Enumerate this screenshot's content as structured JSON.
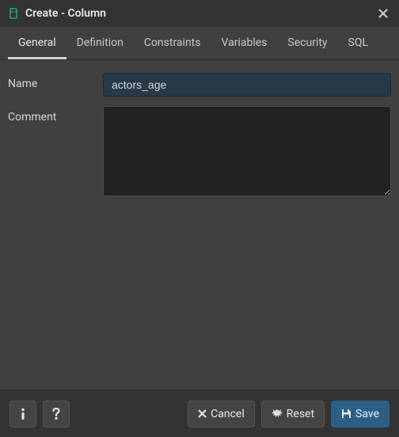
{
  "titlebar": {
    "title": "Create - Column"
  },
  "tabs": [
    {
      "label": "General"
    },
    {
      "label": "Definition"
    },
    {
      "label": "Constraints"
    },
    {
      "label": "Variables"
    },
    {
      "label": "Security"
    },
    {
      "label": "SQL"
    }
  ],
  "form": {
    "name_label": "Name",
    "name_value": "actors_age",
    "comment_label": "Comment",
    "comment_value": ""
  },
  "footer": {
    "cancel": "Cancel",
    "reset": "Reset",
    "save": "Save"
  }
}
